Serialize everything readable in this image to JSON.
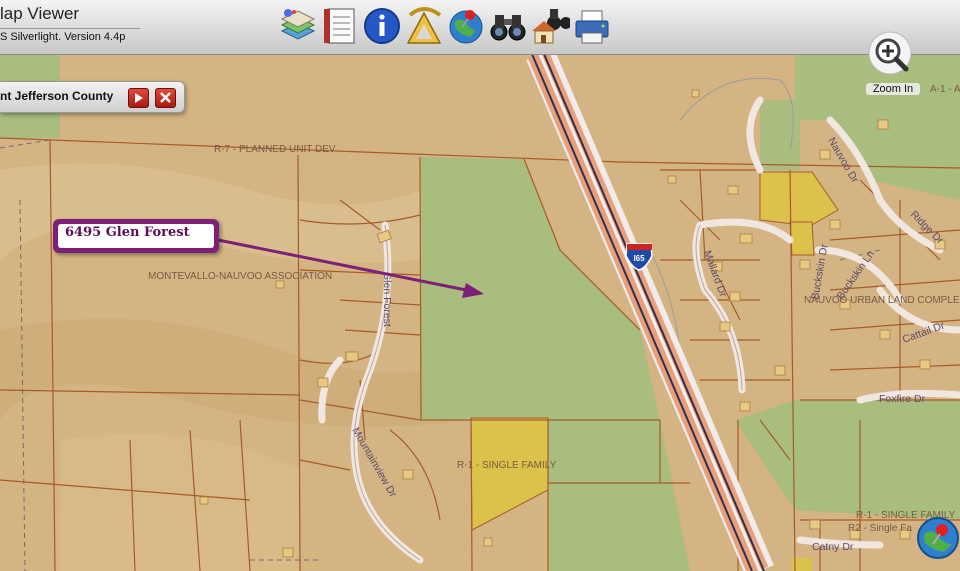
{
  "app": {
    "title": "lap Viewer",
    "subtitle": "S Silverlight. Version 4.4p"
  },
  "toolbar": {
    "tools": [
      "layers-icon",
      "notebook-icon",
      "info-icon",
      "measure-icon",
      "pushpin-globe-icon",
      "binoculars-icon",
      "binoculars-house-icon",
      "printer-icon"
    ]
  },
  "search": {
    "text": "nt Jefferson County"
  },
  "zoom": {
    "label": "Zoom In"
  },
  "callout": {
    "text": "6495 Glen Forest"
  },
  "highway": {
    "shield_number": "I65"
  },
  "map_labels": {
    "zoning_pud": "R-7 - PLANNED UNIT DEV",
    "association": "MONTEVALLO-NAUVOO ASSOCIATION",
    "single_family": "R-1 - SINGLE FAMILY",
    "single_family_2": "R-1 - SINGLE FAMILY",
    "single_family_3": "R2 - Single Fa",
    "land_complex": "NAUVOO URBAN LAND COMPLEX",
    "a1": "A-1 - A"
  },
  "roads": {
    "glen_forest": "Glen Forest",
    "mountainview": "Mountainview Dr",
    "foxfire": "Foxfire Dr",
    "buckskin": "Buckskin Dr",
    "buckskin_ln": "Buckskin Ln",
    "cattail": "Cattail Dr",
    "catny": "Catny Dr",
    "mallard": "Mallard Dr",
    "nauvoo": "Nauvoo Dr",
    "ridge": "Ridge Dr"
  },
  "colors": {
    "parcel_fill": "#d6b685",
    "green_area": "#a9bd7e",
    "yellow_parcel": "#dcc24a",
    "parcel_line": "#a85a2a",
    "callout": "#7e1f78"
  }
}
